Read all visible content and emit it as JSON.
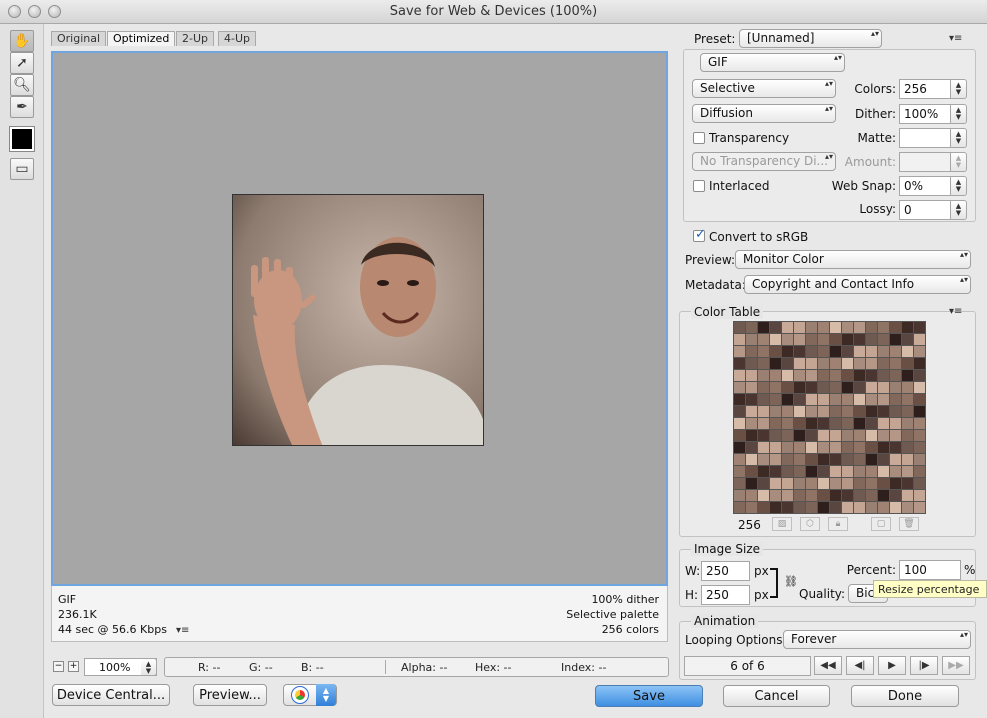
{
  "window": {
    "title": "Save for Web & Devices (100%)"
  },
  "tabs": [
    {
      "label": "Original"
    },
    {
      "label": "Optimized"
    },
    {
      "label": "2-Up"
    },
    {
      "label": "4-Up"
    }
  ],
  "info": {
    "format": "GIF",
    "size": "236.1K",
    "time": "44 sec @ 56.6 Kbps",
    "dither": "100% dither",
    "palette": "Selective palette",
    "colors": "256 colors"
  },
  "status": {
    "zoom": "100%",
    "r": "R: --",
    "g": "G: --",
    "b": "B: --",
    "alpha": "Alpha: --",
    "hex": "Hex: --",
    "index": "Index: --"
  },
  "buttons": {
    "device_central": "Device Central...",
    "preview": "Preview...",
    "save": "Save",
    "cancel": "Cancel",
    "done": "Done"
  },
  "settings": {
    "preset_label": "Preset:",
    "preset_value": "[Unnamed]",
    "format_value": "GIF",
    "reduction_value": "Selective",
    "colors_label": "Colors:",
    "colors_value": "256",
    "dither_algo_value": "Diffusion",
    "dither_label": "Dither:",
    "dither_value": "100%",
    "transparency_label": "Transparency",
    "matte_label": "Matte:",
    "matte_value": "",
    "transparency_dither_value": "No Transparency Di...",
    "amount_label": "Amount:",
    "amount_value": "",
    "interlaced_label": "Interlaced",
    "websnap_label": "Web Snap:",
    "websnap_value": "0%",
    "lossy_label": "Lossy:",
    "lossy_value": "0",
    "convert_label": "Convert to sRGB",
    "preview_label": "Preview:",
    "preview_value": "Monitor Color",
    "metadata_label": "Metadata:",
    "metadata_value": "Copyright and Contact Info"
  },
  "color_table": {
    "title": "Color Table",
    "count": "256",
    "palette": [
      "#6e5a50",
      "#a08272",
      "#3d2a25",
      "#c4a493",
      "#8f7466",
      "#5a4640",
      "#b59787",
      "#7c6558",
      "#d6bba9",
      "#4a3530",
      "#9a8072",
      "#6a4f44",
      "#c9a997",
      "#82685b",
      "#2e1f1c",
      "#a88d7e"
    ]
  },
  "image_size": {
    "title": "Image Size",
    "w_label": "W:",
    "w_value": "250",
    "h_label": "H:",
    "h_value": "250",
    "unit": "px",
    "percent_label": "Percent:",
    "percent_value": "100",
    "percent_unit": "%",
    "quality_label": "Quality:",
    "quality_value": "Bicu",
    "tooltip": "Resize percentage"
  },
  "animation": {
    "title": "Animation",
    "looping_label": "Looping Options:",
    "looping_value": "Forever",
    "frame": "6 of 6"
  }
}
